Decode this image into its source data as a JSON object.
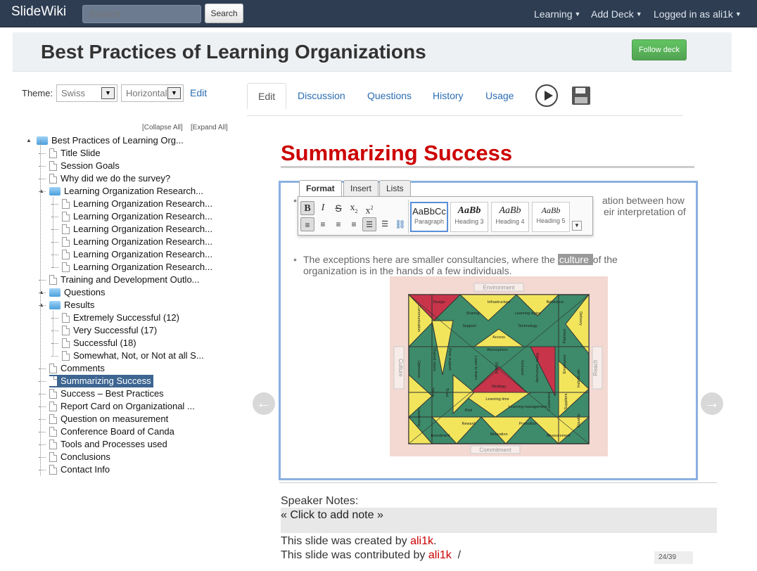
{
  "navbar": {
    "brand": "SlideWiki",
    "search_placeholder": "Search",
    "search_button": "Search",
    "menu_learning": "Learning",
    "menu_add_deck": "Add Deck",
    "menu_user": "Logged in as ali1k"
  },
  "header": {
    "title": "Best Practices of Learning Organizations",
    "follow_button": "Follow deck"
  },
  "theme": {
    "label": "Theme:",
    "theme_value": "Swiss",
    "transition_value": "Horizontal",
    "edit_link": "Edit"
  },
  "tree": {
    "collapse_all": "Collapse All",
    "expand_all": "Expand All",
    "root": "Best Practices of Learning Org...",
    "items": [
      "Title Slide",
      "Session Goals",
      "Why did we do the survey?",
      "Learning Organization Research...",
      "Learning Organization Research...",
      "Learning Organization Research...",
      "Learning Organization Research...",
      "Learning Organization Research...",
      "Learning Organization Research...",
      "Learning Organization Research...",
      "Training and Development Outlo...",
      "Questions",
      "Results",
      "Extremely Successful (12)",
      "Very Successful (17)",
      "Successful (18)",
      "Somewhat, Not, or Not at all S...",
      "Comments",
      "Summarizing Success",
      "Success – Best Practices",
      "Report Card on Organizational ...",
      "Question on measurement",
      "Conference Board of Canda",
      "Tools and Processes used",
      "Conclusions",
      "Contact Info"
    ]
  },
  "tabs": {
    "edit": "Edit",
    "discussion": "Discussion",
    "questions": "Questions",
    "history": "History",
    "usage": "Usage"
  },
  "slide": {
    "title": "Summarizing Success",
    "bullet1_line1_tail": "ation between how",
    "bullet1_line2_tail": "eir interpretation of",
    "bullet2_pre": "The exceptions here are smaller consultancies, where the ",
    "bullet2_hl": "culture ",
    "bullet2_post": "of the",
    "bullet2_line2": "organization is in the hands of a few individuals."
  },
  "format_toolbar": {
    "tab_format": "Format",
    "tab_insert": "Insert",
    "tab_lists": "Lists",
    "styles": [
      {
        "sample": "AaBbCc",
        "caption": "Paragraph"
      },
      {
        "sample": "AaBb",
        "caption": "Heading 3"
      },
      {
        "sample": "AaBb",
        "caption": "Heading 4"
      },
      {
        "sample": "AaBb",
        "caption": "Heading 5"
      }
    ]
  },
  "diagram": {
    "top": "Environment",
    "bottom": "Commitment",
    "left": "Culture",
    "right": "Reach",
    "cells": [
      "Design",
      "Infrastructure",
      "Behaviour",
      "Sharing",
      "Learning styles",
      "Support",
      "Technology",
      "Access",
      "Atmosphere",
      "Strategy",
      "Learning time",
      "Learning management",
      "Risk",
      "Reward",
      "Motivation",
      "Promotion",
      "Investment",
      "Measurement",
      "Communication",
      "Delivery",
      "Shared vision",
      "Peer support",
      "Openness",
      "Value",
      "Trust",
      "Leadership",
      "Partners",
      "Employees",
      "Customers",
      "Suppliers",
      "Individuals",
      "Equality",
      "Learn to learn",
      "Skilled",
      "Inclusive",
      "Wider community"
    ]
  },
  "notes": {
    "label": "Speaker Notes:",
    "placeholder": "« Click to add note »",
    "created_pre": "This slide was created by ",
    "created_user": "ali1k",
    "created_post": ".",
    "contrib_pre": "This slide was contributed by ",
    "contrib_user": "ali1k",
    "contrib_post": "  /",
    "page_count": "24/39"
  },
  "colors": {
    "navbar": "#2e3d52",
    "accent_red": "#cc0000",
    "link_blue": "#2a6db3",
    "selected_tree": "#3d6591",
    "follow_green": "#51a351"
  }
}
